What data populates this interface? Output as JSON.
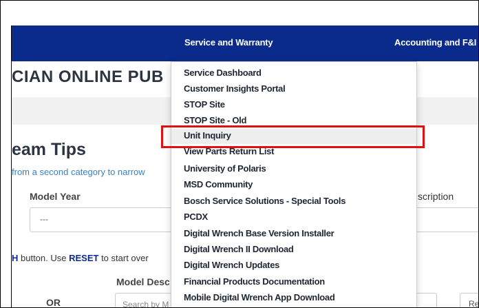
{
  "topnav": {
    "service_warranty": "Service and Warranty",
    "accounting": "Accounting and F&I"
  },
  "page_title": "CIAN ONLINE PUB",
  "section": {
    "title": "eam Tips",
    "hint": "from a second category to narrow"
  },
  "filters": {
    "model_year_label": "Model Year",
    "model_year_value": "---",
    "description_label": "scription",
    "model_desc_label": "Model Desc",
    "or_label": "OR",
    "search_placeholder": "Search by M",
    "right_button": "Re"
  },
  "instructions": {
    "prefix": "H",
    "part1": " button. Use ",
    "reset": "RESET",
    "part2": " to start over"
  },
  "dropdown": {
    "items": [
      "Service Dashboard",
      "Customer Insights Portal",
      "STOP Site",
      "STOP Site - Old",
      "Unit Inquiry",
      "View Parts Return List",
      "University of Polaris",
      "MSD Community",
      "Bosch Service Solutions - Special Tools",
      "PCDX",
      "Digital Wrench Base Version Installer",
      "Digital Wrench II Download",
      "Digital Wrench Updates",
      "Financial Products Documentation",
      "Mobile Digital Wrench App Download"
    ]
  }
}
